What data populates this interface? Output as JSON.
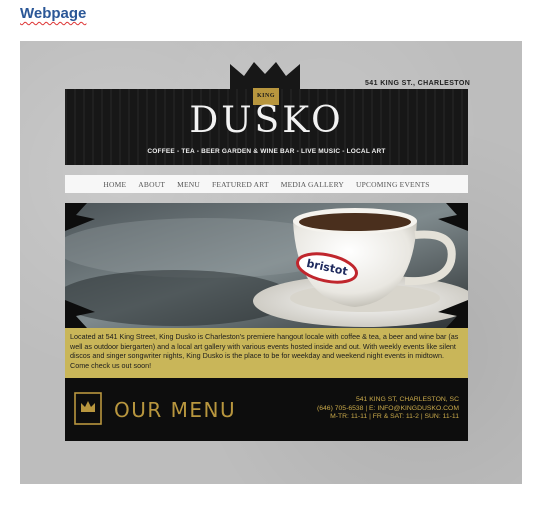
{
  "document": {
    "heading": "Webpage"
  },
  "site": {
    "address_top": "541 KING ST., CHARLESTON",
    "badge": "KING",
    "brand": "DUSKO",
    "tagline": "COFFEE - TEA - BEER GARDEN & WINE BAR - LIVE MUSIC - LOCAL ART",
    "nav": [
      "HOME",
      "ABOUT",
      "MENU",
      "FEATURED ART",
      "MEDIA GALLERY",
      "UPCOMING EVENTS"
    ],
    "hero": {
      "cup_text": "bristot"
    },
    "about": "Located at 541 King Street, King Dusko is Charleston's premiere hangout locale with coffee & tea, a beer and wine bar (as well as outdoor biergarten) and a local art gallery with various events hosted inside and out. With weekly events like silent discos and singer songwriter nights, King Dusko is the place to be for weekday and weekend night events in midtown. Come check us out soon!",
    "footer": {
      "menu_label": "OUR MENU",
      "contact_line1": "541 KING ST, CHARLESTON, SC",
      "contact_line2": "(646) 705-6538 | E: INFO@KINGDUSKO.COM",
      "contact_line3": "M-TR: 11-11 | FR & SAT: 11-2 | SUN: 11-11"
    }
  },
  "colors": {
    "heading_blue": "#2b5797",
    "gold": "#b8963e",
    "about_bg": "#c9b659",
    "dark": "#0d0d0d"
  }
}
